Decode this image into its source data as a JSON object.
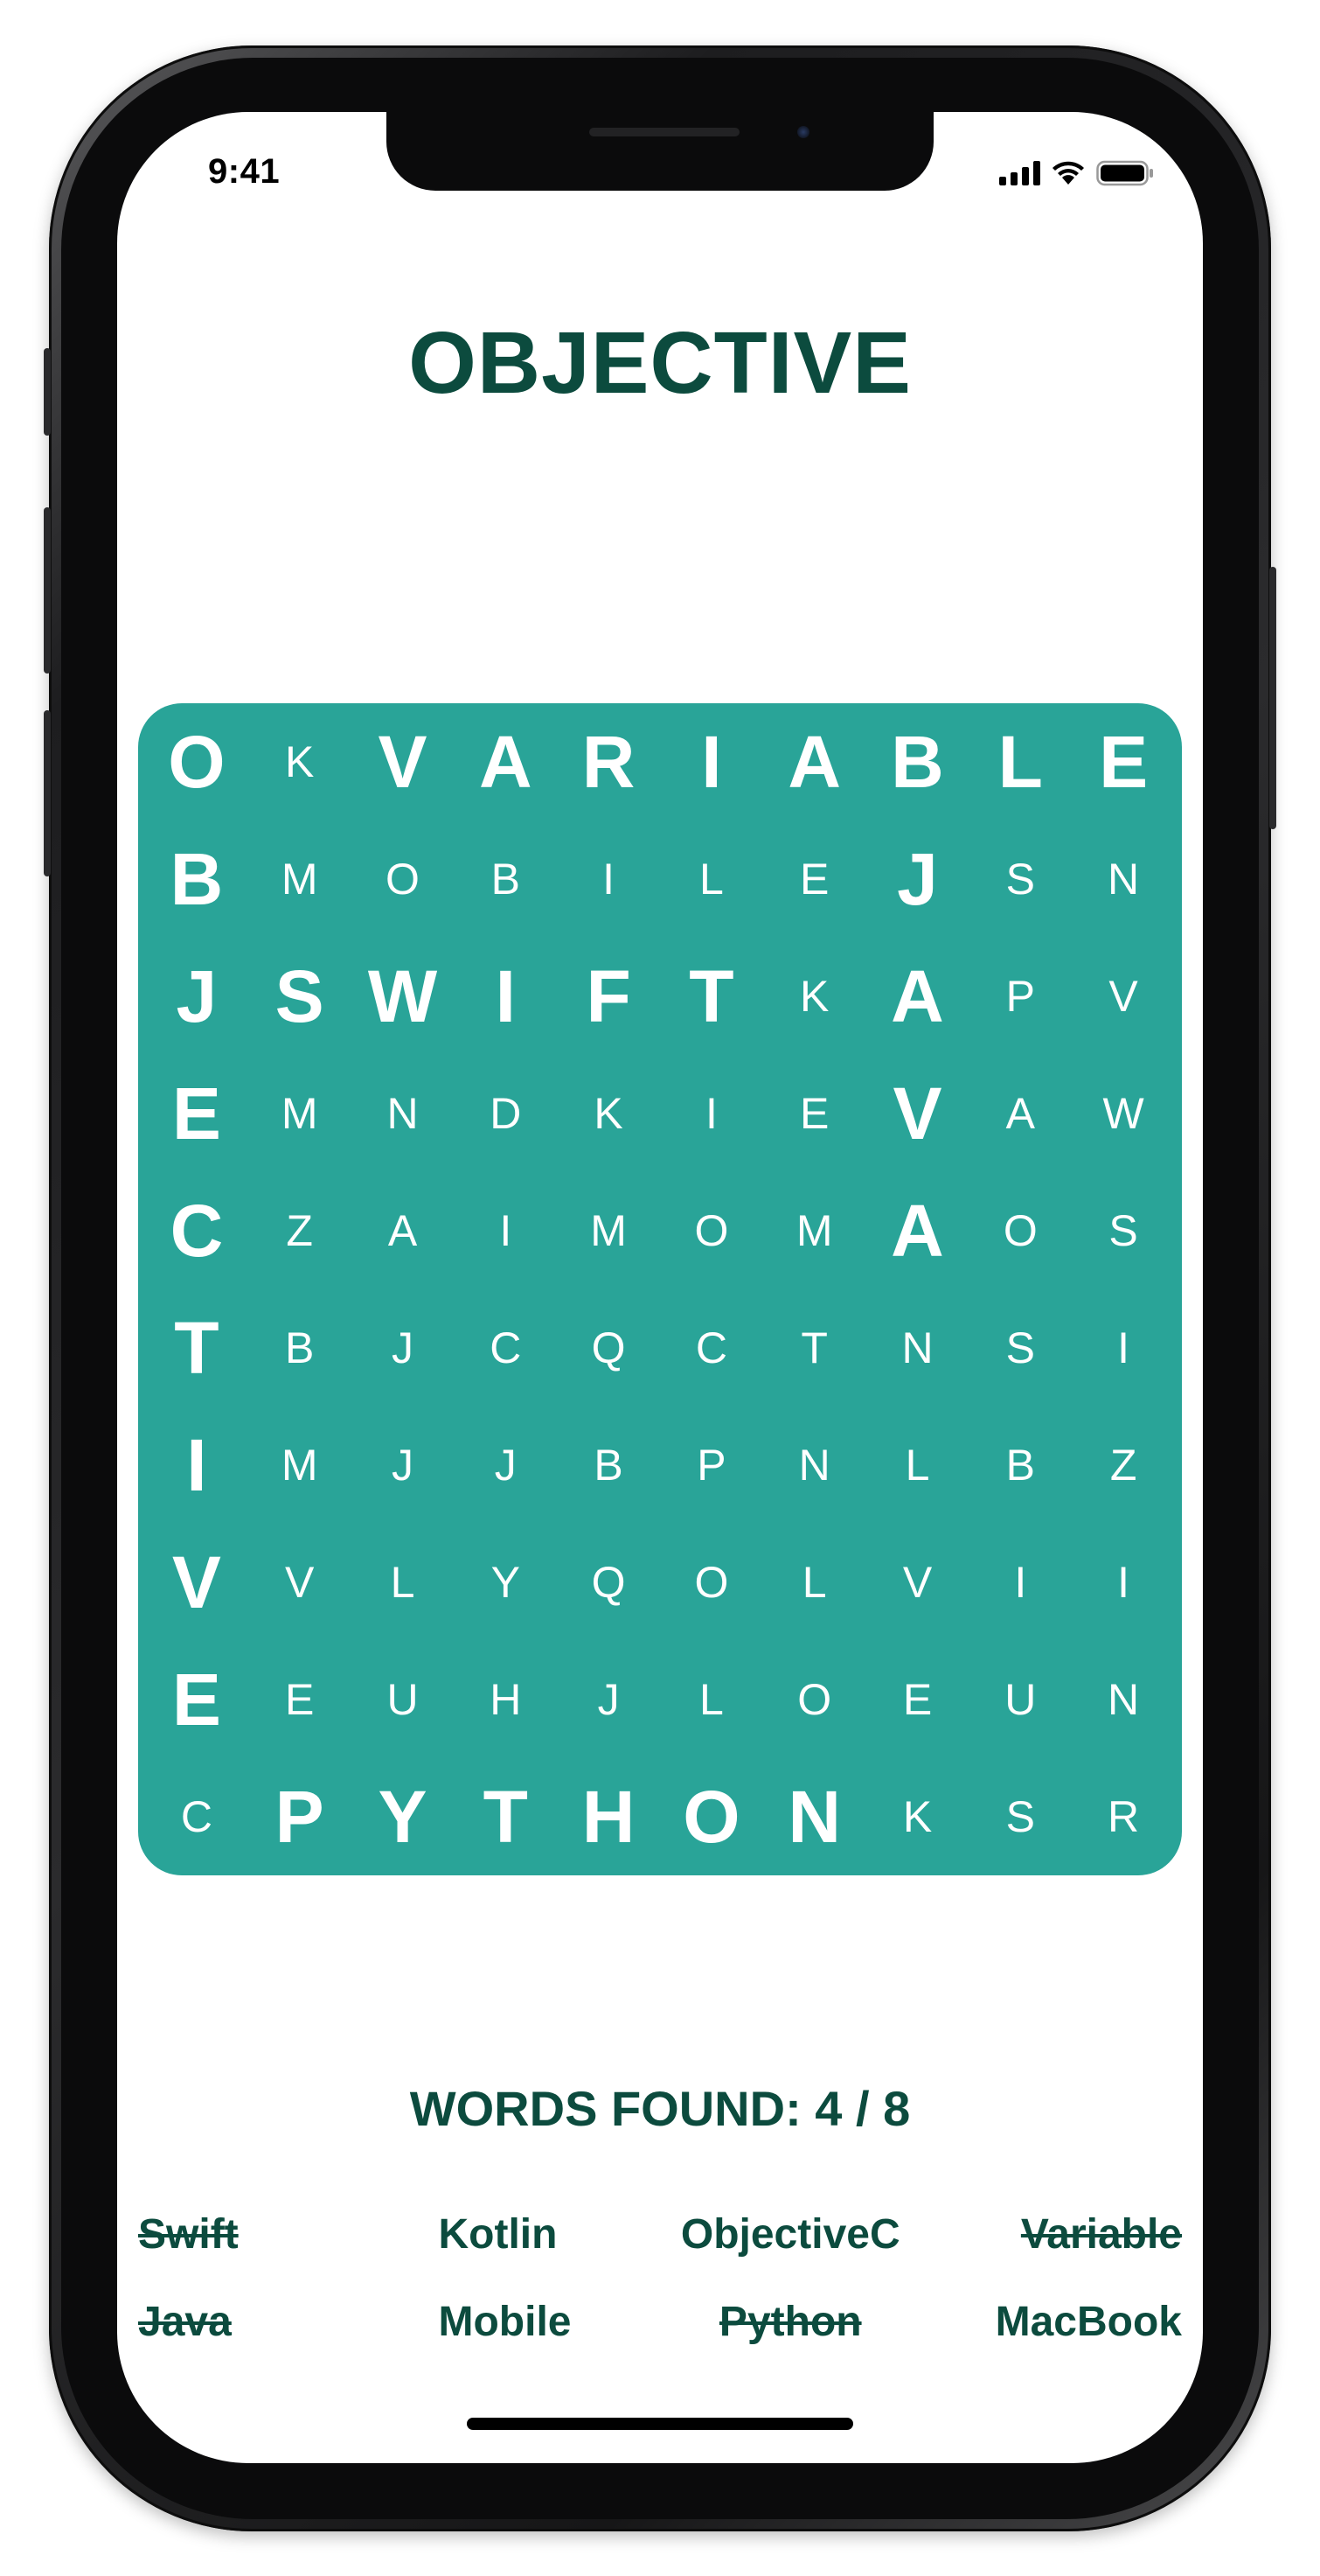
{
  "status_bar": {
    "time": "9:41",
    "icons": [
      "signal-icon",
      "wifi-icon",
      "battery-icon"
    ]
  },
  "title": "OBJECTIVE",
  "colors": {
    "accent_dark": "#0c4b3e",
    "grid_background": "#29a498",
    "grid_letter": "#ffffff"
  },
  "grid": {
    "rows": [
      [
        "O",
        "K",
        "V",
        "A",
        "R",
        "I",
        "A",
        "B",
        "L",
        "E"
      ],
      [
        "B",
        "M",
        "O",
        "B",
        "I",
        "L",
        "E",
        "J",
        "S",
        "N"
      ],
      [
        "J",
        "S",
        "W",
        "I",
        "F",
        "T",
        "K",
        "A",
        "P",
        "V"
      ],
      [
        "E",
        "M",
        "N",
        "D",
        "K",
        "I",
        "E",
        "V",
        "A",
        "W"
      ],
      [
        "C",
        "Z",
        "A",
        "I",
        "M",
        "O",
        "M",
        "A",
        "O",
        "S"
      ],
      [
        "T",
        "B",
        "J",
        "C",
        "Q",
        "C",
        "T",
        "N",
        "S",
        "I"
      ],
      [
        "I",
        "M",
        "J",
        "J",
        "B",
        "P",
        "N",
        "L",
        "B",
        "Z"
      ],
      [
        "V",
        "V",
        "L",
        "Y",
        "Q",
        "O",
        "L",
        "V",
        "I",
        "I"
      ],
      [
        "E",
        "E",
        "U",
        "H",
        "J",
        "L",
        "O",
        "E",
        "U",
        "N"
      ],
      [
        "C",
        "P",
        "Y",
        "T",
        "H",
        "O",
        "N",
        "K",
        "S",
        "R"
      ]
    ],
    "found_cells": [
      [
        0,
        0
      ],
      [
        0,
        2
      ],
      [
        0,
        3
      ],
      [
        0,
        4
      ],
      [
        0,
        5
      ],
      [
        0,
        6
      ],
      [
        0,
        7
      ],
      [
        0,
        8
      ],
      [
        0,
        9
      ],
      [
        1,
        0
      ],
      [
        1,
        7
      ],
      [
        2,
        0
      ],
      [
        2,
        1
      ],
      [
        2,
        2
      ],
      [
        2,
        3
      ],
      [
        2,
        4
      ],
      [
        2,
        5
      ],
      [
        2,
        7
      ],
      [
        3,
        0
      ],
      [
        3,
        7
      ],
      [
        4,
        0
      ],
      [
        4,
        7
      ],
      [
        5,
        0
      ],
      [
        6,
        0
      ],
      [
        7,
        0
      ],
      [
        8,
        0
      ],
      [
        9,
        1
      ],
      [
        9,
        2
      ],
      [
        9,
        3
      ],
      [
        9,
        4
      ],
      [
        9,
        5
      ],
      [
        9,
        6
      ]
    ]
  },
  "progress": {
    "label": "WORDS FOUND: 4 / 8",
    "found": 4,
    "total": 8
  },
  "words": [
    {
      "text": "Swift",
      "found": true
    },
    {
      "text": "Kotlin",
      "found": false
    },
    {
      "text": "ObjectiveC",
      "found": false
    },
    {
      "text": "Variable",
      "found": true
    },
    {
      "text": "Java",
      "found": true
    },
    {
      "text": "Mobile",
      "found": false
    },
    {
      "text": "Python",
      "found": true
    },
    {
      "text": "MacBook",
      "found": false
    }
  ]
}
